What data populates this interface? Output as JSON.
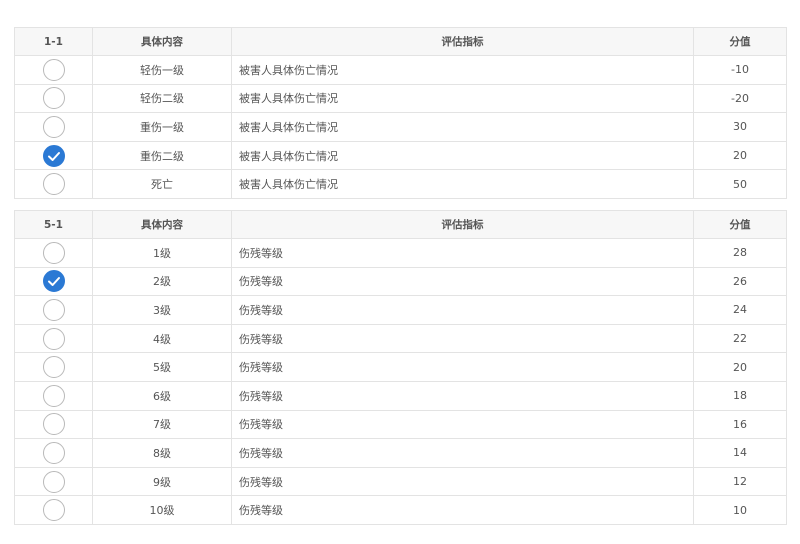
{
  "colors": {
    "check_fill": "#2b79d4",
    "radio_border": "#b9b9b9",
    "header_bg": "#f7f7f7",
    "grid_line": "#e3e3e3"
  },
  "icons": {
    "unchecked": "empty-circle-radio-icon",
    "checked": "check-circle-icon"
  },
  "tables": [
    {
      "id": "1-1",
      "headers": {
        "code": "1-1",
        "content": "具体内容",
        "indicator": "评估指标",
        "score": "分值"
      },
      "rows": [
        {
          "checked": false,
          "content": "轻伤一级",
          "indicator": "被害人具体伤亡情况",
          "score": "-10"
        },
        {
          "checked": false,
          "content": "轻伤二级",
          "indicator": "被害人具体伤亡情况",
          "score": "-20"
        },
        {
          "checked": false,
          "content": "重伤一级",
          "indicator": "被害人具体伤亡情况",
          "score": "30"
        },
        {
          "checked": true,
          "content": "重伤二级",
          "indicator": "被害人具体伤亡情况",
          "score": "20"
        },
        {
          "checked": false,
          "content": "死亡",
          "indicator": "被害人具体伤亡情况",
          "score": "50"
        }
      ]
    },
    {
      "id": "5-1",
      "headers": {
        "code": "5-1",
        "content": "具体内容",
        "indicator": "评估指标",
        "score": "分值"
      },
      "rows": [
        {
          "checked": false,
          "content": "1级",
          "indicator": "伤残等级",
          "score": "28"
        },
        {
          "checked": true,
          "content": "2级",
          "indicator": "伤残等级",
          "score": "26"
        },
        {
          "checked": false,
          "content": "3级",
          "indicator": "伤残等级",
          "score": "24"
        },
        {
          "checked": false,
          "content": "4级",
          "indicator": "伤残等级",
          "score": "22"
        },
        {
          "checked": false,
          "content": "5级",
          "indicator": "伤残等级",
          "score": "20"
        },
        {
          "checked": false,
          "content": "6级",
          "indicator": "伤残等级",
          "score": "18"
        },
        {
          "checked": false,
          "content": "7级",
          "indicator": "伤残等级",
          "score": "16"
        },
        {
          "checked": false,
          "content": "8级",
          "indicator": "伤残等级",
          "score": "14"
        },
        {
          "checked": false,
          "content": "9级",
          "indicator": "伤残等级",
          "score": "12"
        },
        {
          "checked": false,
          "content": "10级",
          "indicator": "伤残等级",
          "score": "10"
        }
      ]
    }
  ]
}
